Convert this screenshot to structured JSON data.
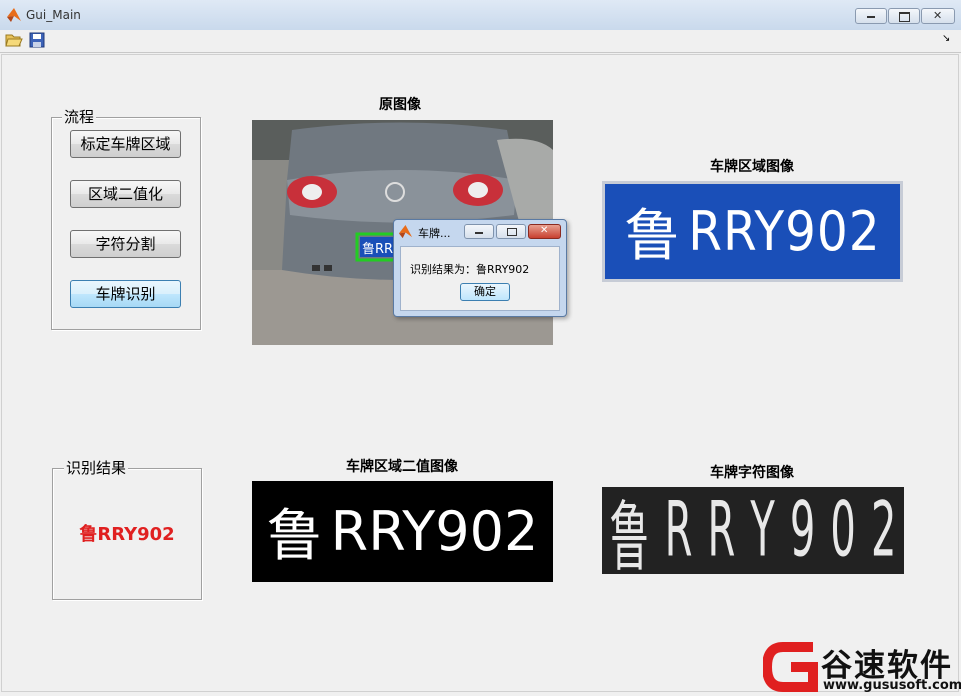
{
  "window": {
    "title": "Gui_Main",
    "min_glyph": "▭",
    "max_glyph": "▣",
    "close_glyph": "✕"
  },
  "toolbar": {
    "open_icon": "folder-open-icon",
    "save_icon": "save-icon",
    "dock_glyph": "↘"
  },
  "process_panel": {
    "title": "流程",
    "buttons": [
      "标定车牌区域",
      "区域二值化",
      "字符分割",
      "车牌识别"
    ]
  },
  "result_panel": {
    "title": "识别结果",
    "value": "鲁RRY902",
    "value_color": "#e02020"
  },
  "axes": {
    "original": "原图像",
    "plate_region": "车牌区域图像",
    "plate_binary": "车牌区域二值图像",
    "plate_chars": "车牌字符图像"
  },
  "images": {
    "plate_text_prefix": "鲁",
    "plate_text_rest": "RRY902",
    "plate_chars": [
      "鲁",
      "R",
      "R",
      "Y",
      "9",
      "0",
      "2"
    ],
    "detected_overlay": "鲁RR"
  },
  "dialog": {
    "title": "车牌...",
    "message": "识别结果为：鲁RRY902",
    "ok": "确定"
  },
  "watermark": {
    "brand": "谷速软件",
    "url": "www.gususoft.com",
    "logo_color": "#e02020"
  }
}
